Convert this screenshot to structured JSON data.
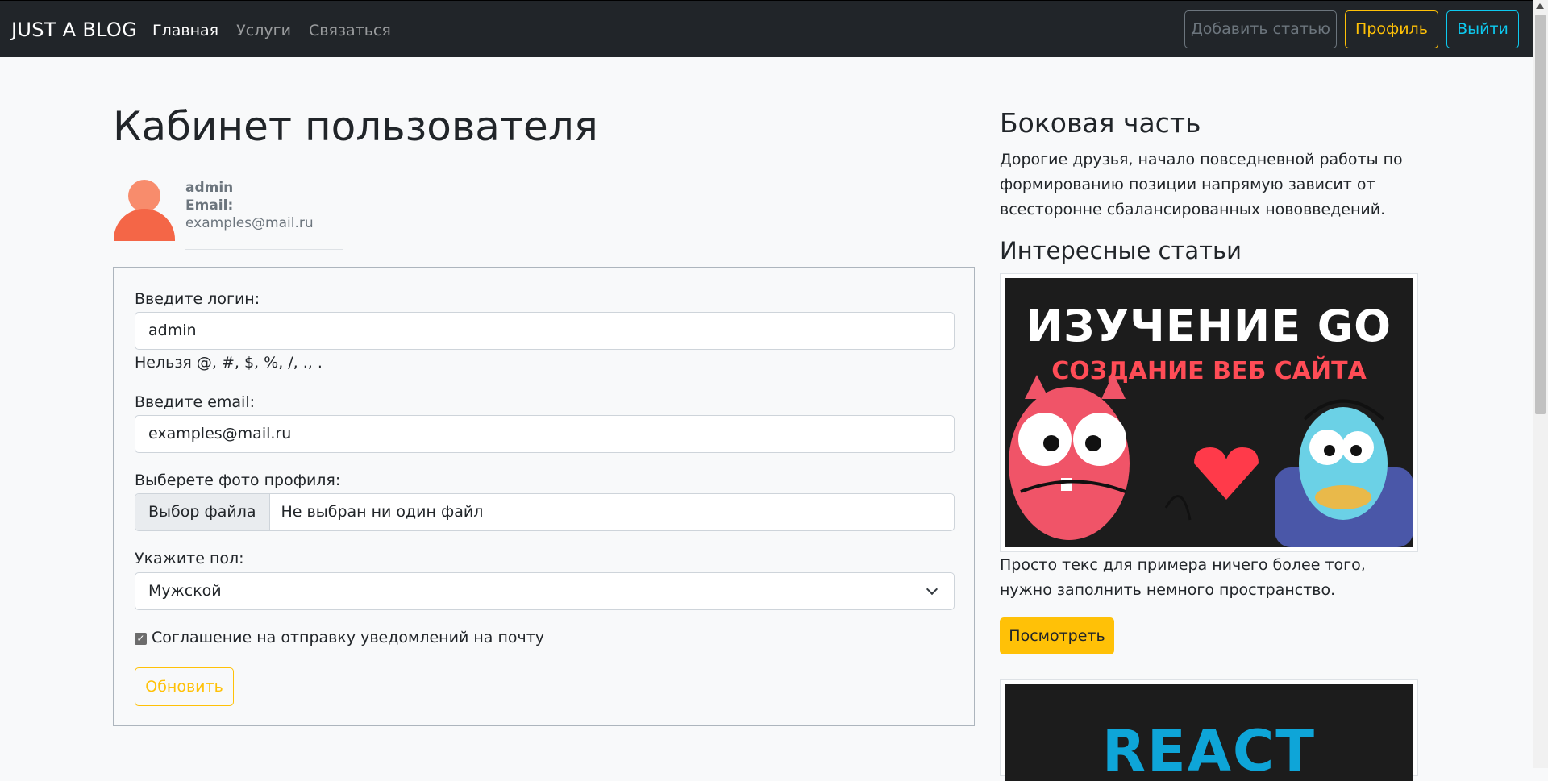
{
  "navbar": {
    "brand": "JUST A BLOG",
    "links": [
      "Главная",
      "Услуги",
      "Связаться"
    ],
    "add_article": "Добавить статью",
    "profile": "Профиль",
    "logout": "Выйти"
  },
  "main": {
    "title": "Кабинет пользователя",
    "user": {
      "name": "admin",
      "email_label": "Email:",
      "email": "examples@mail.ru"
    },
    "form": {
      "login_label": "Введите логин:",
      "login_value": "admin",
      "login_hint": "Нельзя @, #, $, %, /, ., .",
      "email_label": "Введите email:",
      "email_value": "examples@mail.ru",
      "photo_label": "Выберете фото профиля:",
      "file_button": "Выбор файла",
      "file_status": "Не выбран ни один файл",
      "gender_label": "Укажите пол:",
      "gender_value": "Мужской",
      "notify_checkbox": "Соглашение на отправку уведомлений на почту",
      "notify_checked": true,
      "update_button": "Обновить"
    }
  },
  "sidebar": {
    "title": "Боковая часть",
    "text": "Дорогие друзья, начало повседневной работы по формированию позиции напрямую зависит от всесторонне сбалансированных нововведений.",
    "articles_title": "Интересные статьи",
    "article1": {
      "image_title": "ИЗУЧЕНИЕ GO",
      "image_subtitle": "СОЗДАНИЕ ВЕБ САЙТА",
      "text": "Просто текс для примера ничего более того, нужно заполнить немного пространство.",
      "button": "Посмотреть"
    },
    "article2": {
      "image_title": "REACT"
    }
  },
  "colors": {
    "navbar_bg": "#212529",
    "warning": "#ffc107",
    "info": "#0dcaf0",
    "secondary": "#6c757d",
    "avatar": "#f46647"
  }
}
